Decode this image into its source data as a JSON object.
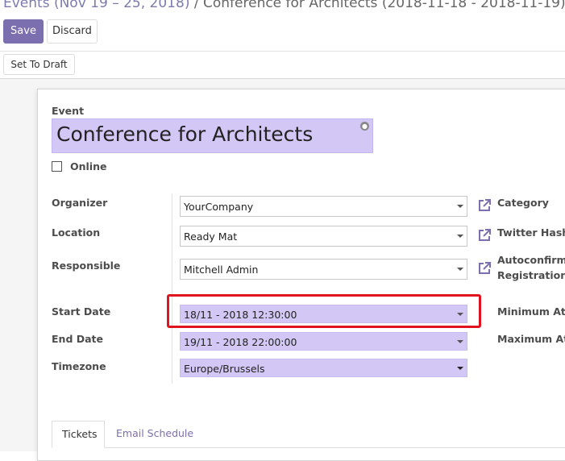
{
  "breadcrumb": {
    "parent": "Events (Nov 19 – 25, 2018)",
    "separator": " / ",
    "current": "Conference for Architects (2018-11-18 - 2018-11-19)"
  },
  "buttons": {
    "save": "Save",
    "discard": "Discard",
    "set_to_draft": "Set To Draft"
  },
  "form": {
    "event_label": "Event",
    "event_name": "Conference for Architects",
    "online_label": "Online",
    "online_checked": false,
    "left_fields": {
      "organizer": {
        "label": "Organizer",
        "value": "YourCompany"
      },
      "location": {
        "label": "Location",
        "value": "Ready Mat"
      },
      "responsible": {
        "label": "Responsible",
        "value": "Mitchell Admin"
      },
      "start_date": {
        "label": "Start Date",
        "value": "18/11 - 2018 12:30:00"
      },
      "end_date": {
        "label": "End Date",
        "value": "19/11 - 2018 22:00:00"
      },
      "timezone": {
        "label": "Timezone",
        "value": "Europe/Brussels"
      }
    },
    "right_labels": {
      "category": "Category",
      "twitter": "Twitter Hashta",
      "autoconfirm_1": "Autoconfirm",
      "autoconfirm_2": "Registrations",
      "min_attendees": "Minimum Atte",
      "max_attendees": "Maximum Atte"
    }
  },
  "tabs": [
    "Tickets",
    "Email Schedule"
  ],
  "colors": {
    "accent": "#7c6fb0",
    "required_field": "#d2c7f5",
    "highlight": "#e0141e"
  },
  "icons": [
    "globe-icon",
    "external-link-icon",
    "caret-down-icon"
  ]
}
